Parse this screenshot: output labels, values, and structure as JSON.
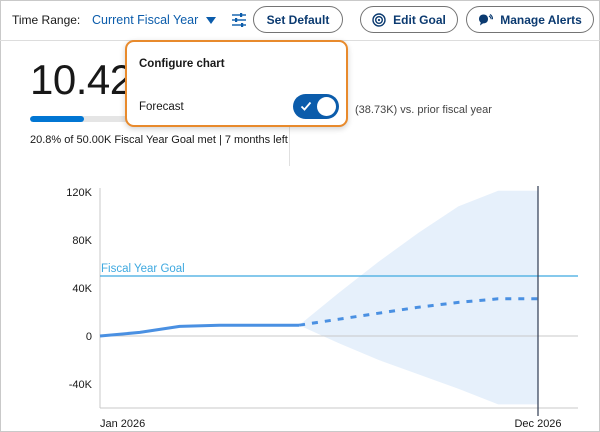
{
  "header": {
    "time_range_label": "Time Range:",
    "time_range_value": "Current Fiscal Year",
    "set_default_label": "Set Default",
    "edit_goal_label": "Edit Goal",
    "manage_alerts_label": "Manage Alerts"
  },
  "metric": {
    "value": "10.42",
    "progress_percent": 20.8,
    "goal_note": "20.8% of 50.00K Fiscal Year Goal met | 7 months left",
    "prior_comparison": "(38.73K) vs. prior fiscal year"
  },
  "popover": {
    "title": "Configure chart",
    "forecast_label": "Forecast",
    "forecast_enabled": true
  },
  "colors": {
    "accent": "#0b5cab",
    "series": "#4a90e2",
    "goal_line": "#3fa9e0",
    "forecast_band": "#e6f0fb",
    "popover_border": "#e88a2c"
  },
  "chart_data": {
    "type": "line",
    "ylim": [
      -60000,
      130000
    ],
    "y_ticks": [
      120000,
      80000,
      40000,
      0,
      -40000
    ],
    "y_tick_labels": [
      "120K",
      "80K",
      "40K",
      "0",
      "-40K"
    ],
    "x_range": [
      0,
      11
    ],
    "x_tick_labels": [
      {
        "x": 0,
        "label": "Jan 2026"
      },
      {
        "x": 11,
        "label": "Dec 2026"
      }
    ],
    "goal": {
      "label": "Fiscal Year Goal",
      "value": 50000
    },
    "actual": {
      "x": [
        0,
        1,
        2,
        3,
        4,
        5
      ],
      "y": [
        0,
        3000,
        8000,
        9000,
        9000,
        9000
      ]
    },
    "forecast": {
      "x": [
        5,
        6,
        7,
        8,
        9,
        10,
        11
      ],
      "y": [
        9000,
        14000,
        19000,
        24000,
        28000,
        31000,
        31000
      ],
      "upper": [
        9000,
        36000,
        62000,
        86000,
        108000,
        121000,
        121000
      ],
      "lower": [
        9000,
        -6000,
        -20000,
        -32000,
        -44000,
        -57000,
        -57000
      ]
    },
    "cursor_x": 11
  }
}
